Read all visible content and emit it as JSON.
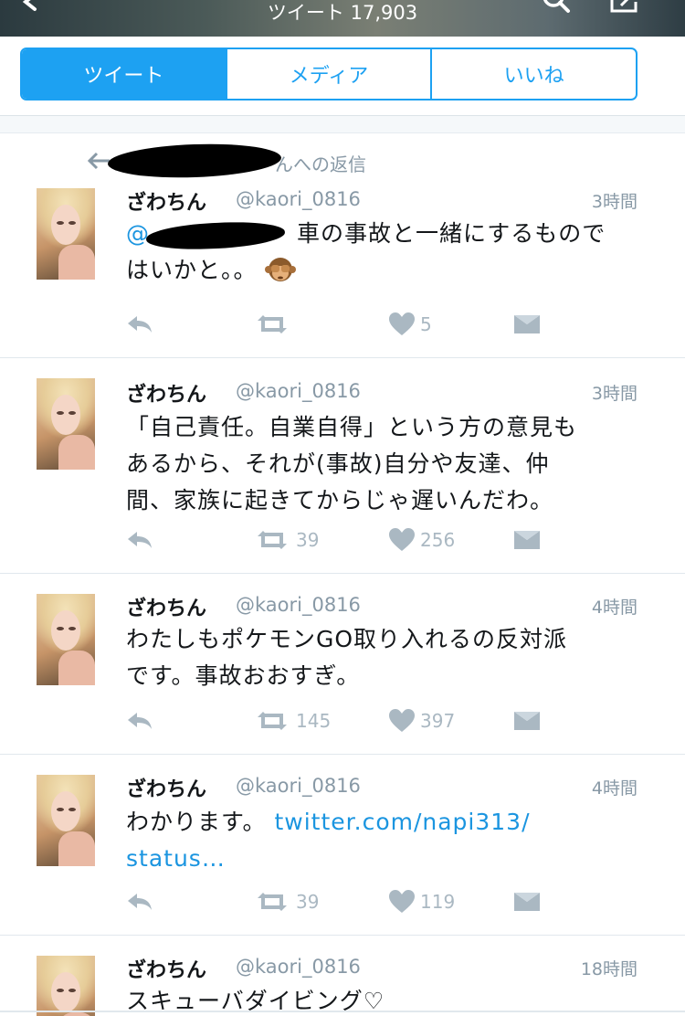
{
  "header": {
    "title": "ツイート 17,903"
  },
  "tabs": [
    {
      "label": "ツイート",
      "active": true
    },
    {
      "label": "メディア",
      "active": false
    },
    {
      "label": "いいね",
      "active": false
    }
  ],
  "reply_context": {
    "text": "んへの返信"
  },
  "tweets": [
    {
      "name": "ざわちん",
      "handle": "@kaori_0816",
      "time": "3時間",
      "mention_prefix": "@",
      "text_line1": "車の事故と一緒にするもので",
      "text_line2": "はいかと。。",
      "retweets": "",
      "likes": "5"
    },
    {
      "name": "ざわちん",
      "handle": "@kaori_0816",
      "time": "3時間",
      "lines": [
        "「自己責任。自業自得」という方の意見も",
        "あるから、それが(事故)自分や友達、仲",
        "間、家族に起きてからじゃ遅いんだわ。"
      ],
      "retweets": "39",
      "likes": "256"
    },
    {
      "name": "ざわちん",
      "handle": "@kaori_0816",
      "time": "4時間",
      "lines": [
        "わたしもポケモンGO取り入れるの反対派",
        "です。事故おおすぎ。"
      ],
      "retweets": "145",
      "likes": "397"
    },
    {
      "name": "ざわちん",
      "handle": "@kaori_0816",
      "time": "4時間",
      "text": "わかります。",
      "link_line1": "twitter.com/napi313/",
      "link_line2": "status…",
      "retweets": "39",
      "likes": "119"
    },
    {
      "name": "ざわちん",
      "handle": "@kaori_0816",
      "time": "18時間",
      "lines": [
        "スキューバダイビング♡"
      ]
    }
  ],
  "colors": {
    "accent": "#1da1f2",
    "muted": "#8899a6",
    "action": "#aab8c2"
  }
}
